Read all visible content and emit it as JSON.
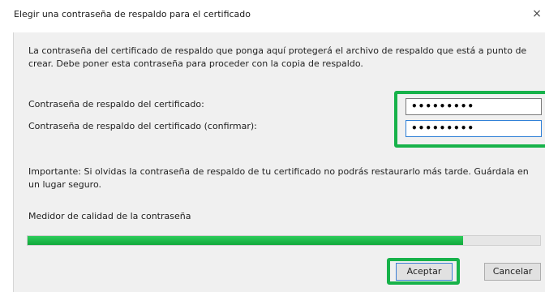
{
  "dialog": {
    "title": "Elegir una contraseña de respaldo para el certificado",
    "close_glyph": "×",
    "intro": "La contraseña del certificado de respaldo que ponga aquí protegerá el archivo de respaldo que está a punto de crear. Debe poner esta contraseña para proceder con la copia de respaldo.",
    "password_label": "Contraseña de respaldo del certificado:",
    "password_value": "•••••••••",
    "confirm_label": "Contraseña de respaldo del certificado (confirmar):",
    "confirm_value": "•••••••••",
    "important": "Importante: Si olvidas la contraseña de respaldo de tu certificado no podrás restaurarlo más tarde. Guárdala en un lugar seguro.",
    "meter_label": "Medidor de calidad de la contraseña",
    "meter_fraction": 0.85,
    "ok_label": "Aceptar",
    "cancel_label": "Cancelar"
  },
  "colors": {
    "highlight": "#17b24a",
    "meter_fill": "#1fb84a",
    "focus_border": "#2f7fd6"
  },
  "icons": {
    "close": "close-icon"
  }
}
